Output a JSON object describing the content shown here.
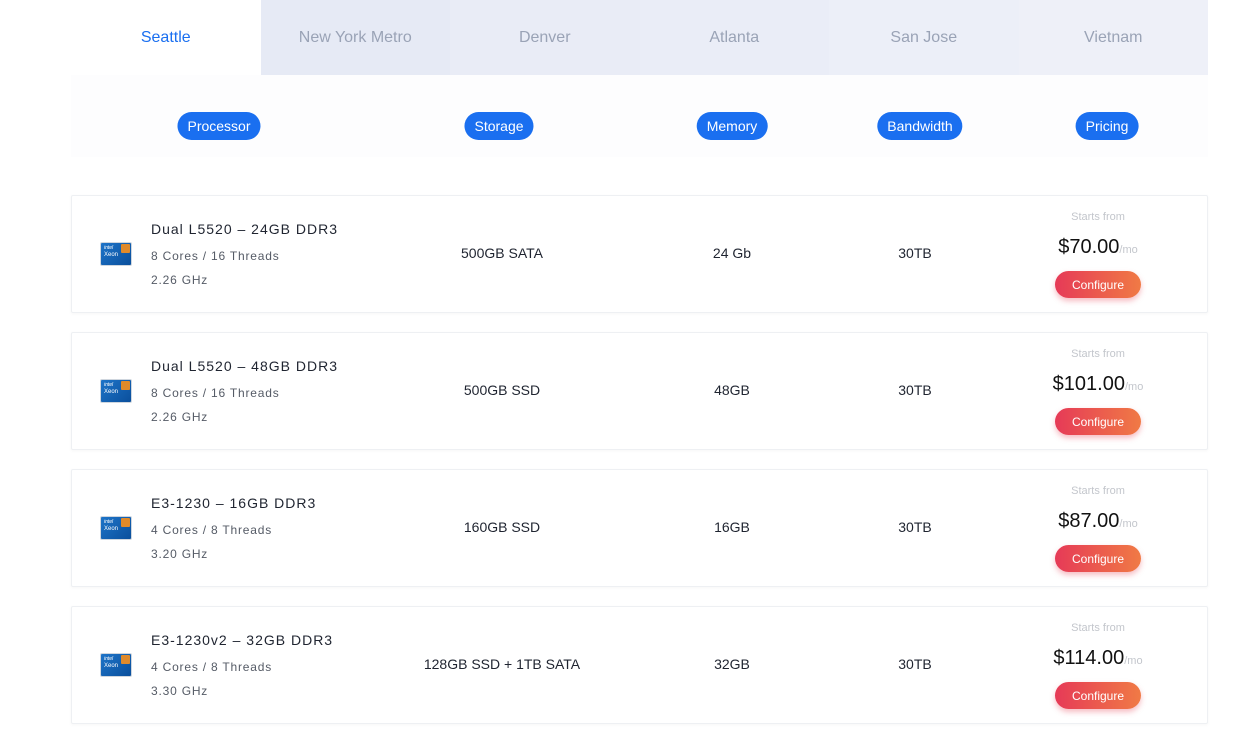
{
  "tabs": [
    "Seattle",
    "New York Metro",
    "Denver",
    "Atlanta",
    "San Jose",
    "Vietnam"
  ],
  "active_tab": "Seattle",
  "columns": {
    "processor": "Processor",
    "storage": "Storage",
    "memory": "Memory",
    "bandwidth": "Bandwidth",
    "pricing": "Pricing"
  },
  "cpu_icon": "intel-xeon-icon",
  "cpu_icon_text": {
    "brand": "intel",
    "line": "Xeon"
  },
  "servers": [
    {
      "name": "Dual L5520 – 24GB DDR3",
      "cores": "8 Cores / 16 Threads",
      "ghz": "2.26 GHz",
      "storage": "500GB SATA",
      "memory": "24 Gb",
      "bandwidth": "30TB",
      "starts_from": "Starts from",
      "price": "$70.00",
      "per": "/mo",
      "button": "Configure"
    },
    {
      "name": "Dual L5520 – 48GB DDR3",
      "cores": "8 Cores / 16 Threads",
      "ghz": "2.26 GHz",
      "storage": "500GB SSD",
      "memory": "48GB",
      "bandwidth": "30TB",
      "starts_from": "Starts from",
      "price": "$101.00",
      "per": "/mo",
      "button": "Configure"
    },
    {
      "name": "E3-1230 – 16GB DDR3",
      "cores": "4 Cores / 8 Threads",
      "ghz": "3.20 GHz",
      "storage": "160GB SSD",
      "memory": "16GB",
      "bandwidth": "30TB",
      "starts_from": "Starts from",
      "price": "$87.00",
      "per": "/mo",
      "button": "Configure"
    },
    {
      "name": "E3-1230v2 – 32GB DDR3",
      "cores": "4 Cores / 8 Threads",
      "ghz": "3.30 GHz",
      "storage": "128GB SSD + 1TB SATA",
      "memory": "32GB",
      "bandwidth": "30TB",
      "starts_from": "Starts from",
      "price": "$114.00",
      "per": "/mo",
      "button": "Configure"
    }
  ],
  "colors": {
    "accent": "#1a6ff0",
    "button_start": "#e63a57",
    "button_end": "#f07a45"
  }
}
